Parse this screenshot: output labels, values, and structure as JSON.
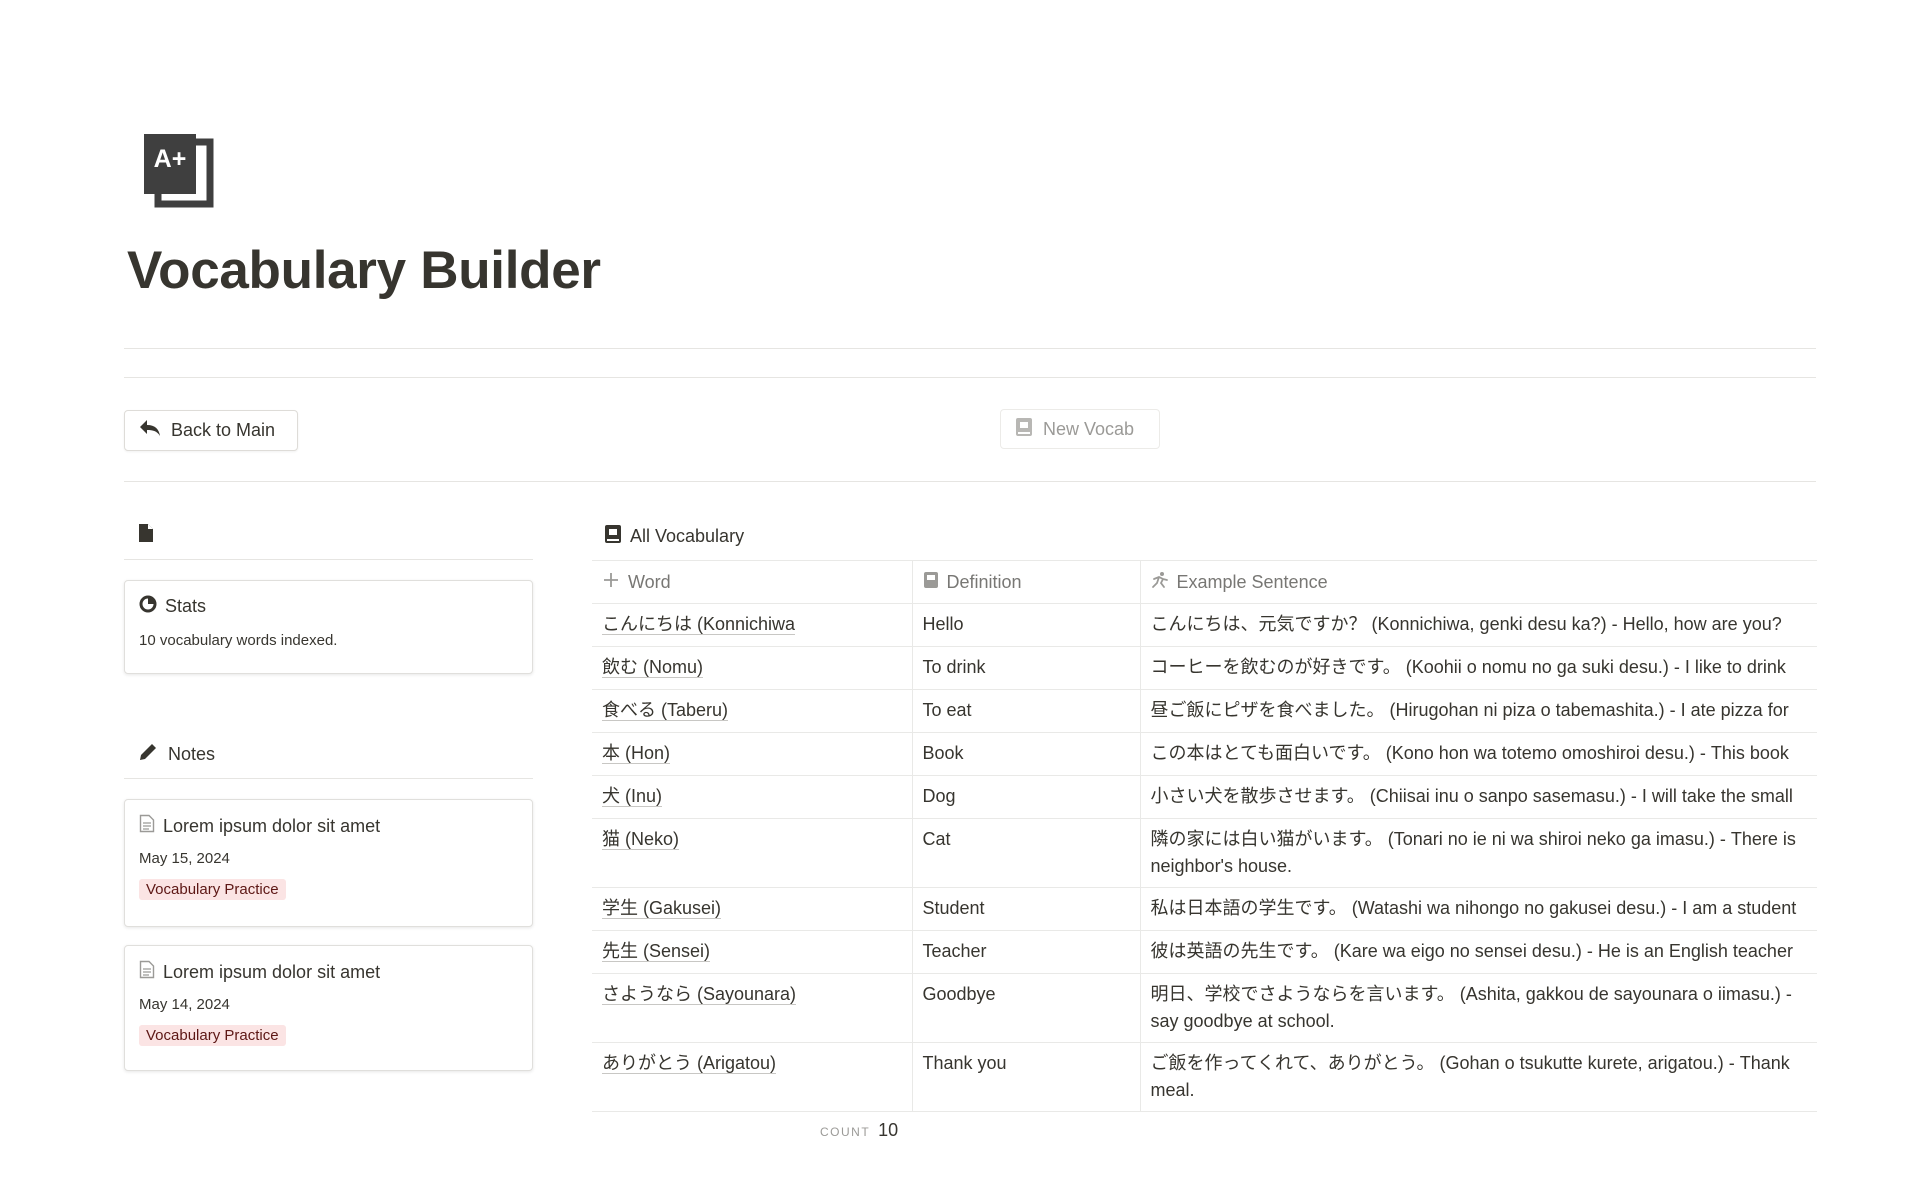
{
  "page": {
    "title": "Vocabulary Builder",
    "icon": "grade-a-plus-icon",
    "icon_text": "A+"
  },
  "toolbar": {
    "back_label": "Back to Main",
    "new_vocab_label": "New Vocab"
  },
  "stats": {
    "title": "Stats",
    "summary": "10 vocabulary words indexed."
  },
  "notes": {
    "title": "Notes",
    "items": [
      {
        "title": "Lorem ipsum dolor sit amet",
        "date": "May 15, 2024",
        "tag": "Vocabulary Practice"
      },
      {
        "title": "Lorem ipsum dolor sit amet",
        "date": "May 14, 2024",
        "tag": "Vocabulary Practice"
      }
    ]
  },
  "vocab_view": {
    "title": "All Vocabulary",
    "columns": [
      "Word",
      "Definition",
      "Example Sentence"
    ],
    "rows": [
      {
        "word": "こんにちは (Konnichiwa",
        "definition": "Hello",
        "example": "こんにちは、元気ですか？ (Konnichiwa, genki desu ka?) - Hello, how are you?"
      },
      {
        "word": "飲む (Nomu)",
        "definition": "To drink",
        "example": "コーヒーを飲むのが好きです。 (Koohii o nomu no ga suki desu.) - I like to drink"
      },
      {
        "word": "食べる (Taberu)",
        "definition": "To eat",
        "example": "昼ご飯にピザを食べました。 (Hirugohan ni piza o tabemashita.) - I ate pizza for"
      },
      {
        "word": "本 (Hon)",
        "definition": "Book",
        "example": "この本はとても面白いです。 (Kono hon wa totemo omoshiroi desu.) - This book"
      },
      {
        "word": "犬 (Inu)",
        "definition": "Dog",
        "example": "小さい犬を散歩させます。 (Chiisai inu o sanpo sasemasu.) - I will take the small"
      },
      {
        "word": "猫 (Neko)",
        "definition": "Cat",
        "example": "隣の家には白い猫がいます。 (Tonari no ie ni wa shiroi neko ga imasu.) - There is",
        "example2": "neighbor's house."
      },
      {
        "word": "学生 (Gakusei)",
        "definition": "Student",
        "example": "私は日本語の学生です。 (Watashi wa nihongo no gakusei desu.) - I am a student"
      },
      {
        "word": "先生 (Sensei)",
        "definition": "Teacher",
        "example": "彼は英語の先生です。 (Kare wa eigo no sensei desu.) - He is an English teacher"
      },
      {
        "word": "さようなら (Sayounara)",
        "definition": "Goodbye",
        "example": "明日、学校でさようならを言います。 (Ashita, gakkou de sayounara o iimasu.) -",
        "example2": "say goodbye at school."
      },
      {
        "word": "ありがとう (Arigatou)",
        "definition": "Thank you",
        "example": "ご飯を作ってくれて、ありがとう。 (Gohan o tsukutte kurete, arigatou.) - Thank",
        "example2": "meal."
      }
    ],
    "count_label": "COUNT",
    "count_value": "10"
  }
}
